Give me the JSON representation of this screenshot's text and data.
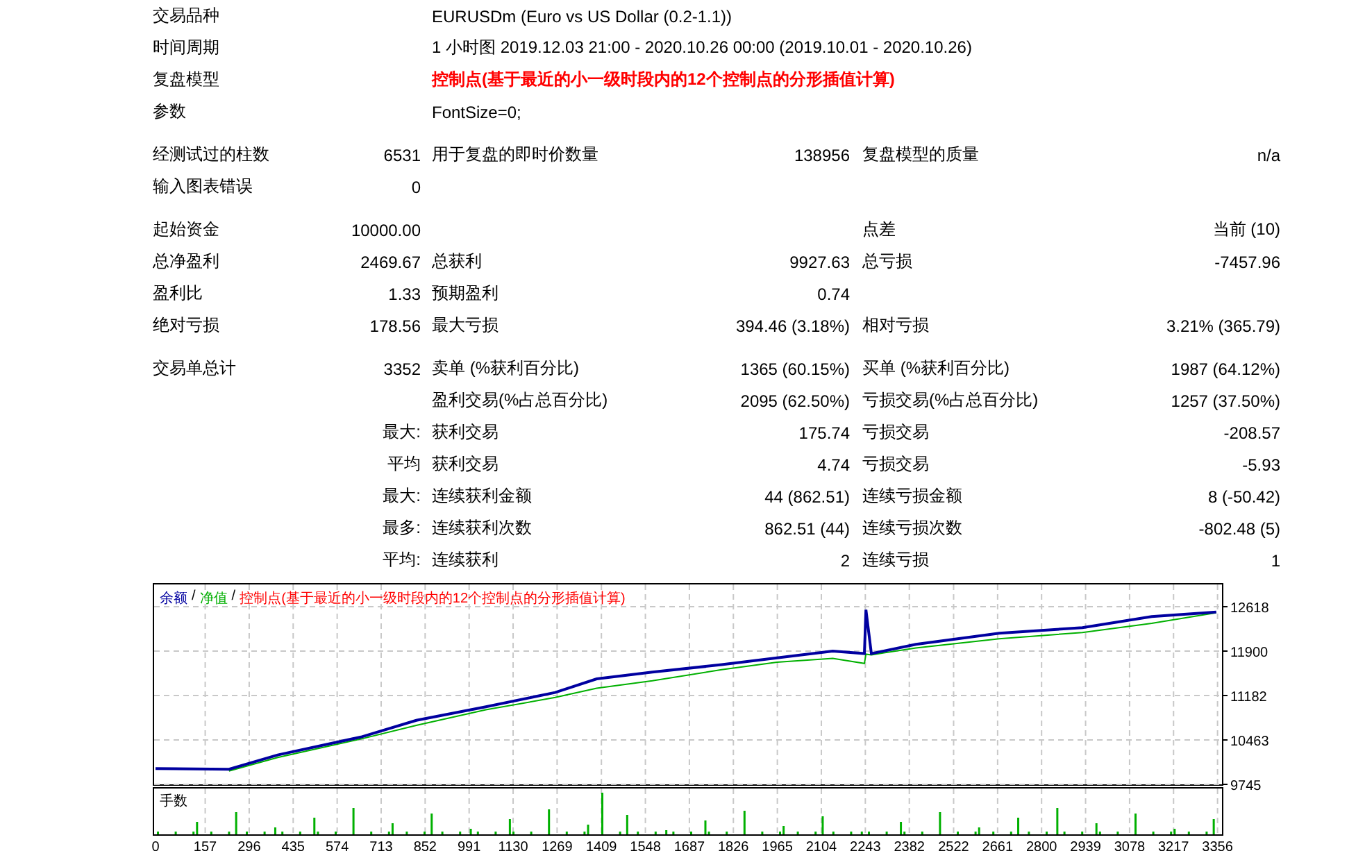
{
  "info": [
    {
      "label": "交易品种",
      "value": "EURUSDm (Euro vs US Dollar (0.2-1.1))",
      "kind": "normal"
    },
    {
      "label": "时间周期",
      "value": "1 小时图 2019.12.03 21:00 - 2020.10.26 00:00 (2019.10.01 - 2020.10.26)",
      "kind": "normal"
    },
    {
      "label": "复盘模型",
      "value": "控制点(基于最近的小一级时段内的12个控制点的分形插值计算)",
      "kind": "highlight"
    },
    {
      "label": "参数",
      "value": "FontSize=0;",
      "kind": "normal"
    }
  ],
  "stat_groups": [
    [
      {
        "label": "经测试过的柱数",
        "value": "6531",
        "label2": "用于复盘的即时价数量",
        "value2": "138956",
        "label3": "复盘模型的质量",
        "value3": "n/a"
      },
      {
        "label": "输入图表错误",
        "value": "0"
      }
    ],
    [
      {
        "label": "起始资金",
        "value": "10000.00",
        "label3": "点差",
        "value3": "当前 (10)"
      },
      {
        "label": "总净盈利",
        "value": "2469.67",
        "label2": "总获利",
        "value2": "9927.63",
        "label3": "总亏损",
        "value3": "-7457.96"
      },
      {
        "label": "盈利比",
        "value": "1.33",
        "label2": "预期盈利",
        "value2": "0.74"
      },
      {
        "label": "绝对亏损",
        "value": "178.56",
        "label2": "最大亏损",
        "value2": "394.46 (3.18%)",
        "label3": "相对亏损",
        "value3": "3.21% (365.79)"
      }
    ],
    [
      {
        "label": "交易单总计",
        "value": "3352",
        "label2": "卖单 (%获利百分比)",
        "value2": "1365 (60.15%)",
        "label3": "买单 (%获利百分比)",
        "value3": "1987 (64.12%)"
      },
      {
        "label2": "盈利交易(%占总百分比)",
        "value2": "2095 (62.50%)",
        "label3": "亏损交易(%占总百分比)",
        "value3": "1257 (37.50%)"
      },
      {
        "qualifier": "最大:",
        "label2": "获利交易",
        "value2": "175.74",
        "label3": "亏损交易",
        "value3": "-208.57"
      },
      {
        "qualifier": "平均",
        "label2": "获利交易",
        "value2": "4.74",
        "label3": "亏损交易",
        "value3": "-5.93"
      },
      {
        "qualifier": "最大:",
        "label2": "连续获利金额",
        "value2": "44 (862.51)",
        "label3": "连续亏损金额",
        "value3": "8 (-50.42)"
      },
      {
        "qualifier": "最多:",
        "label2": "连续获利次数",
        "value2": "862.51 (44)",
        "label3": "连续亏损次数",
        "value3": "-802.48 (5)"
      },
      {
        "qualifier": "平均:",
        "label2": "连续获利",
        "value2": "2",
        "label3": "连续亏损",
        "value3": "1"
      }
    ]
  ],
  "chart": {
    "legend_separator": "/",
    "volume_label": "手数",
    "chart_data": {
      "type": "line",
      "title": "控制点(基于最近的小一级时段内的12个控制点的分形插值计算)",
      "x": [
        0,
        232,
        386,
        649,
        824,
        1044,
        1263,
        1394,
        1570,
        1789,
        1964,
        2140,
        2240,
        2245,
        2262,
        2403,
        2666,
        2929,
        3148,
        3352
      ],
      "series": [
        {
          "name": "余额",
          "color": "#0000a0",
          "values": [
            10000,
            9990,
            10220,
            10510,
            10780,
            11000,
            11230,
            11450,
            11560,
            11680,
            11790,
            11900,
            11860,
            12570,
            11860,
            12010,
            12190,
            12280,
            12460,
            12530
          ]
        },
        {
          "name": "净值",
          "color": "#00b000",
          "values": [
            null,
            9960,
            10180,
            10480,
            10700,
            10950,
            11150,
            11300,
            11420,
            11600,
            11720,
            11780,
            11700,
            11850,
            11840,
            11950,
            12100,
            12200,
            12350,
            12520
          ]
        }
      ],
      "xlim": [
        0,
        3370
      ],
      "ylim": [
        9745,
        13000
      ],
      "grid": true,
      "xticks": [
        0,
        157,
        296,
        435,
        574,
        713,
        852,
        991,
        1130,
        1269,
        1409,
        1548,
        1687,
        1826,
        1965,
        2104,
        2243,
        2382,
        2522,
        2661,
        2800,
        2939,
        3078,
        3217,
        3356
      ],
      "yticks": [
        9745,
        10463,
        11182,
        11900,
        12618
      ]
    }
  }
}
